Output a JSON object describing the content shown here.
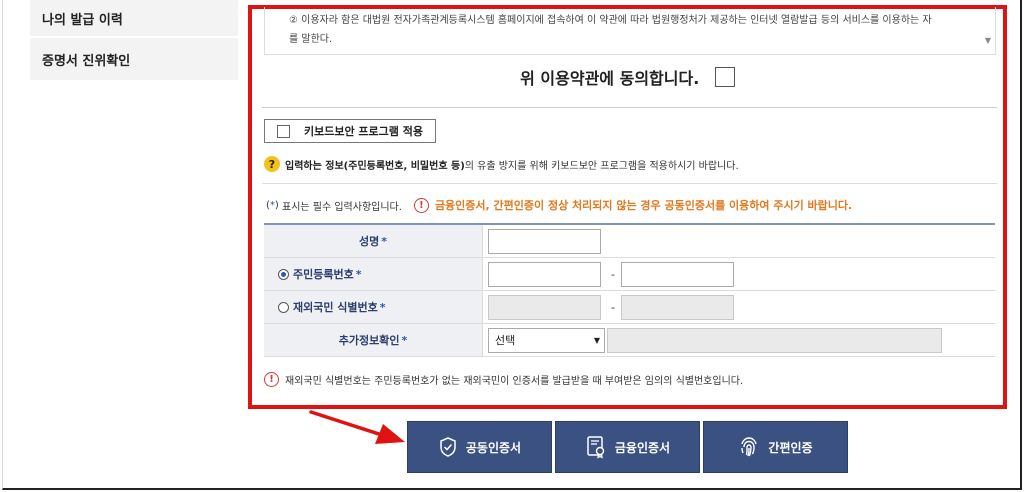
{
  "sidebar": {
    "items": [
      {
        "label": "나의 발급 이력"
      },
      {
        "label": "증명서 진위확인"
      }
    ]
  },
  "terms": {
    "line1": "② 이용자라 함은 대법원 전자가족관계등록시스템 홈페이지에 접속하여 이 약관에 따라 법원행정처가 제공하는 인터넷 열람발급 등의 서비스를 이용하는 자",
    "line2": "를 말한다."
  },
  "agree": {
    "label": "위 이용약관에 동의합니다."
  },
  "keyboard": {
    "button_label": "키보드보안 프로그램 적용",
    "note_bold": "입력하는 정보(주민등록번호, 비밀번호 등)",
    "note_rest": "의 유출 방지를 위해 키보드보안 프로그램을 적용하시기 바랍니다."
  },
  "required": {
    "star": "*",
    "note": "표시는 필수 입력사항입니다.",
    "warning": "금융인증서, 간편인증이 정상 처리되지 않는 경우 공동인증서를 이용하여 주시기 바랍니다."
  },
  "form": {
    "name_label": "성명",
    "rrn_label": "주민등록번호",
    "foreign_label": "재외국민 식별번호",
    "extra_label": "추가정보확인",
    "star": "*",
    "dash": "-",
    "select_value": "선택"
  },
  "foot_note": "재외국민 식별번호는 주민등록번호가 없는 재외국민이 인증서를 발급받을 때 부여받은 임의의 식별번호입니다.",
  "buttons": {
    "joint": "공동인증서",
    "financial": "금융인증서",
    "simple": "간편인증"
  },
  "colors": {
    "highlight": "#e01313",
    "button_bg": "#3a5182",
    "warning_text": "#e07a1f"
  }
}
